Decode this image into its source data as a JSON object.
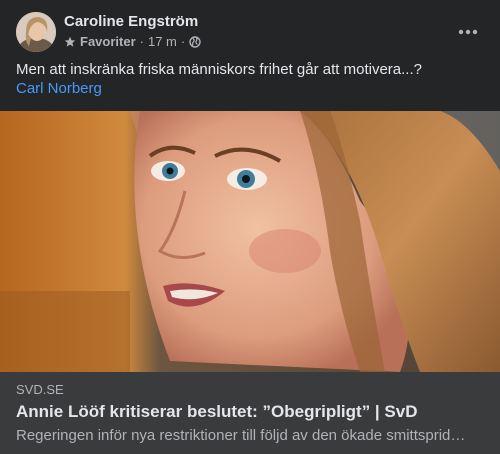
{
  "post": {
    "author": "Caroline Engström",
    "audience_label": "Favoriter",
    "separator": "·",
    "time": "17 m",
    "separator2": "·",
    "text": "Men att inskränka friska människors frihet går att motivera...?",
    "mention": "Carl Norberg",
    "icons": {
      "star": "star-icon",
      "privacy": "globe-icon",
      "more": "more-horizontal-icon"
    }
  },
  "link_preview": {
    "domain": "SVD.SE",
    "title": "Annie Lööf kritiserar beslutet: ”Obegripligt” | SvD",
    "description": "Regeringen inför nya restriktioner till följd av den ökade smittspridningen"
  },
  "colors": {
    "background": "#242526",
    "card": "#3a3b3c",
    "primary_text": "#e4e6eb",
    "secondary_text": "#b0b3b8",
    "link": "#4599ff"
  }
}
